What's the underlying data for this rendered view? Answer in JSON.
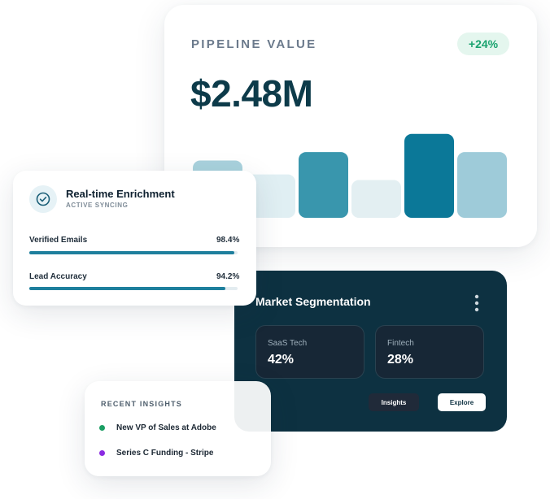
{
  "pipeline": {
    "title": "PIPELINE VALUE",
    "change": "+24%",
    "value": "$2.48M",
    "bars": [
      {
        "level": 0.41,
        "color": "#a9d2dd"
      },
      {
        "level": 0.31,
        "color": "#e0eff3"
      },
      {
        "level": 0.47,
        "color": "#3996ad"
      },
      {
        "level": 0.27,
        "color": "#e3eff2"
      },
      {
        "level": 0.6,
        "color": "#0b7898"
      },
      {
        "level": 0.47,
        "color": "#9ecbd9"
      }
    ]
  },
  "enrichment": {
    "title": "Real-time Enrichment",
    "subtitle": "ACTIVE SYNCING",
    "icon": "check-circle-icon",
    "metrics": [
      {
        "label": "Verified Emails",
        "value": "98.4%",
        "level": 0.984
      },
      {
        "label": "Lead Accuracy",
        "value": "94.2%",
        "level": 0.942
      }
    ]
  },
  "market": {
    "title": "Market Segmentation",
    "menu_icon": "more-vertical-icon",
    "segments": [
      {
        "label": "SaaS Tech",
        "value": "42%"
      },
      {
        "label": "Fintech",
        "value": "28%"
      }
    ],
    "insights_button": "Insights",
    "explore_button": "Explore"
  },
  "recent": {
    "title": "RECENT INSIGHTS",
    "items": [
      {
        "text": "New VP of Sales at Adobe",
        "color": "#1a9e63"
      },
      {
        "text": "Series C Funding - Stripe",
        "color": "#8b2be2"
      }
    ]
  },
  "colors": {
    "accent": "#1e7f9d",
    "dark_panel": "#0d3141",
    "positive": "#1aa36f"
  }
}
